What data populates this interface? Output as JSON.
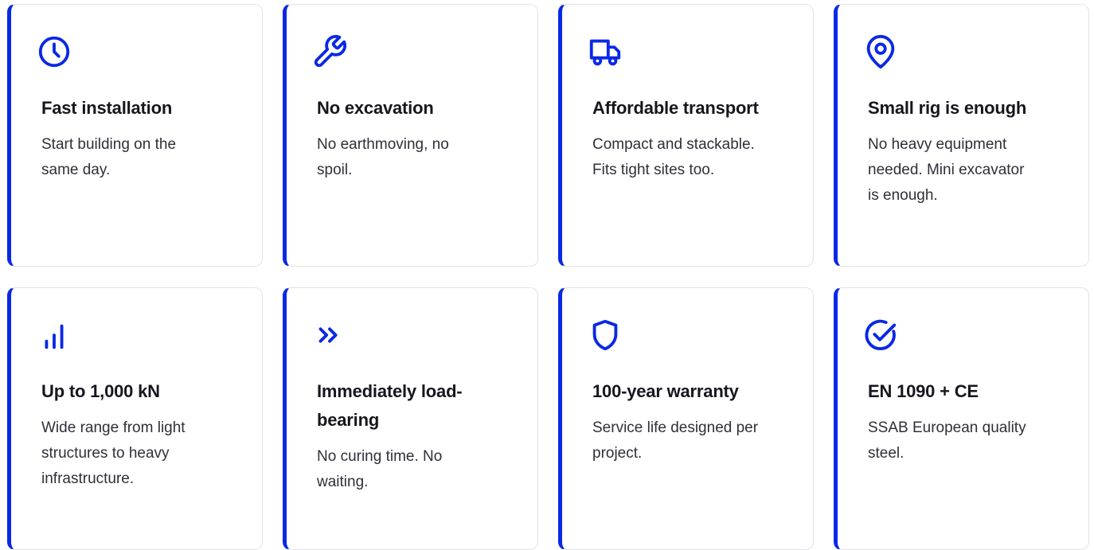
{
  "accent_color": "#0a28e6",
  "features": [
    {
      "icon": "clock-icon",
      "title": "Fast installation",
      "description": "Start building on the same day."
    },
    {
      "icon": "wrench-icon",
      "title": "No excavation",
      "description": "No earthmoving, no spoil."
    },
    {
      "icon": "truck-icon",
      "title": "Affordable transport",
      "description": "Compact and stackable. Fits tight sites too."
    },
    {
      "icon": "map-pin-icon",
      "title": "Small rig is enough",
      "description": "No heavy equipment needed. Mini excavator is enough."
    },
    {
      "icon": "signal-bars-icon",
      "title": "Up to 1,000 kN",
      "description": "Wide range from light structures to heavy infrastructure."
    },
    {
      "icon": "chevrons-right-icon",
      "title": "Immediately load-bearing",
      "description": "No curing time. No waiting."
    },
    {
      "icon": "shield-icon",
      "title": "100-year warranty",
      "description": "Service life designed per project."
    },
    {
      "icon": "check-circle-icon",
      "title": "EN 1090 + CE",
      "description": "SSAB European quality steel."
    }
  ]
}
